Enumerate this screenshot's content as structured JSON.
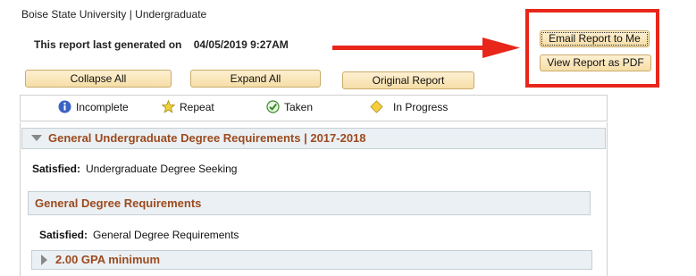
{
  "header": {
    "institution": "Boise State University | Undergraduate",
    "generated_label": "This report last generated on",
    "generated_date": "04/05/2019",
    "generated_time": "9:27AM"
  },
  "toolbar": {
    "collapse_label": "Collapse All",
    "expand_label": "Expand All",
    "original_label": "Original Report",
    "email_label": "Email Report to Me",
    "pdf_label": "View Report as PDF"
  },
  "legend": {
    "items": [
      {
        "label": "Incomplete",
        "icon": "info-icon"
      },
      {
        "label": "Repeat",
        "icon": "star-icon"
      },
      {
        "label": "Taken",
        "icon": "check-icon"
      },
      {
        "label": "In Progress",
        "icon": "diamond-icon"
      }
    ]
  },
  "sections": [
    {
      "title": "General Undergraduate Degree Requirements | 2017-2018",
      "status_label": "Satisfied:",
      "status_text": "Undergraduate Degree Seeking"
    },
    {
      "title": "General Degree Requirements",
      "status_label": "Satisfied:",
      "status_text": "General Degree Requirements"
    },
    {
      "title": "2.00 GPA minimum"
    }
  ],
  "colors": {
    "button_bg": "#f6dda6",
    "section_title": "#9c4a1e",
    "section_bar": "#eaf0f3",
    "annotation_red": "#e8261a"
  }
}
